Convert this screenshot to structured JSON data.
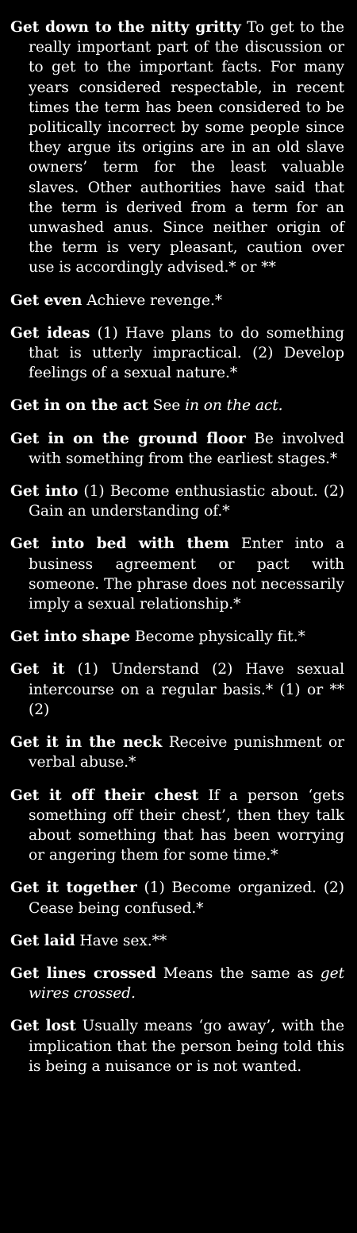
{
  "entries": [
    {
      "headword": "Get down to the nitty gritty",
      "definition": " To get to the really important part of the discussion or to get to the important facts. For many years considered respectable, in recent times the term has been considered to be politically incorrect by some people since they argue its origins are in an old slave owners’ term for the least valuable slaves. Other authorities have said that the term is derived from a term for an unwashed anus. Since neither origin of the term is very pleasant, caution over use is accordingly advised.* or **"
    },
    {
      "headword": "Get even",
      "definition": " Achieve revenge.*"
    },
    {
      "headword": "Get ideas",
      "definition": " (1) Have plans to do something that is utterly impractical. (2) Develop feelings of a sexual nature.*"
    },
    {
      "headword": "Get in on the act",
      "definition": " See ",
      "crossref": "in on the act.",
      "after": ""
    },
    {
      "headword": "Get in on the ground floor",
      "definition": " Be involved with something from the earliest stages.*"
    },
    {
      "headword": "Get into",
      "definition": " (1) Become enthusiastic about. (2) Gain an understanding of.*"
    },
    {
      "headword": "Get into bed with them",
      "definition": " Enter into a business agreement or pact with someone. The phrase does not necessarily imply a sexual relationship.*"
    },
    {
      "headword": "Get into shape",
      "definition": " Become physically fit.*"
    },
    {
      "headword": "Get it",
      "definition": " (1) Understand (2) Have sexual intercourse on a regular basis.* (1) or ** (2)"
    },
    {
      "headword": "Get it in the neck",
      "definition": " Receive punishment or verbal abuse.*"
    },
    {
      "headword": "Get it off their chest",
      "definition": " If a person ‘gets something off their chest’, then they talk about something that has been worrying or angering them for some time.*"
    },
    {
      "headword": "Get it together",
      "definition": " (1) Become organized. (2) Cease being confused.*"
    },
    {
      "headword": "Get laid",
      "definition": " Have sex.**"
    },
    {
      "headword": "Get lines crossed",
      "definition": " Means the same as ",
      "crossref": "get wires crossed.",
      "after": ""
    },
    {
      "headword": "Get lost",
      "definition": " Usually means ‘go away’, with the implication that the person being told this is being a nuisance or is not wanted."
    }
  ]
}
